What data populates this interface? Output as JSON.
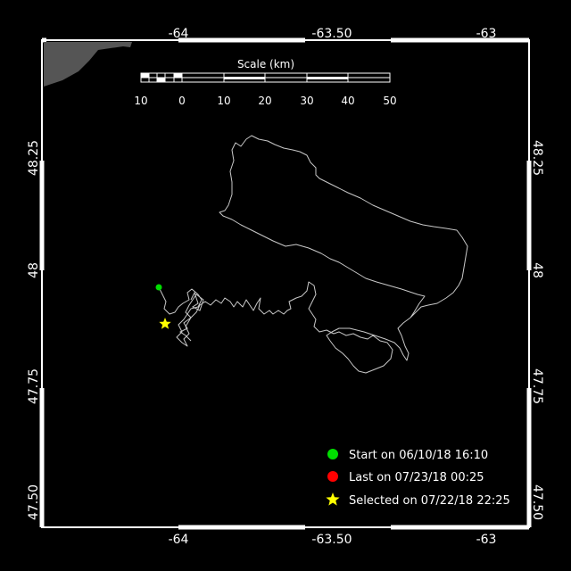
{
  "map": {
    "lon_ticks": [
      "-64",
      "-63.50",
      "-63"
    ],
    "lat_ticks": [
      "48.25",
      "48",
      "47.75",
      "47.50"
    ],
    "scale_title": "Scale (km)",
    "scale_labels": [
      "10",
      "0",
      "10",
      "20",
      "30",
      "40",
      "50"
    ],
    "legend": {
      "start": "Start on 06/10/18 16:10",
      "last": "Last on 07/23/18 00:25",
      "selected": "Selected on 07/22/18 22:25"
    },
    "colors": {
      "background": "#000000",
      "frame": "#ffffff",
      "land": "#555555",
      "track": "#c8c8c8",
      "start": "#00dd00",
      "last": "#ff0000",
      "selected": "#ffff00"
    }
  }
}
